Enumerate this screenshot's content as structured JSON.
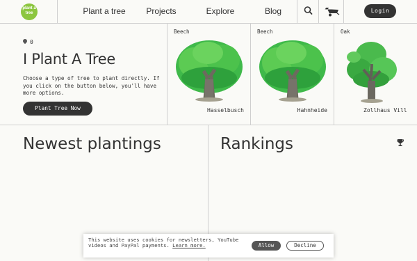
{
  "header": {
    "logo_text": "plant a tree",
    "nav": [
      "Plant a tree",
      "Projects",
      "Explore",
      "Blog"
    ],
    "login_label": "Login"
  },
  "hero": {
    "pin_count": "0",
    "title": "I Plant A Tree",
    "description": "Choose a type of tree to plant directly. If you click on the button below, you'll have more options.",
    "button_label": "Plant Tree Now"
  },
  "cards": [
    {
      "species": "Beech",
      "name": "Hasselbusch",
      "icon": "beech-tree-image"
    },
    {
      "species": "Beech",
      "name": "Hahnheide",
      "icon": "beech-tree-image"
    },
    {
      "species": "Oak",
      "name": "Zollhaus Vill",
      "icon": "oak-tree-image"
    }
  ],
  "sections": {
    "newest": "Newest plantings",
    "rankings": "Rankings",
    "rankings_icon": "trophy-icon"
  },
  "cookie": {
    "text": "This website uses cookies for newsletters, YouTube videos and PayPal payments.",
    "link": "Learn more.",
    "allow": "Allow",
    "decline": "Decline"
  },
  "colors": {
    "brand_green": "#8cc63f",
    "dark_button": "#333333",
    "background": "#fafaf7",
    "border": "#cfcfcf"
  }
}
